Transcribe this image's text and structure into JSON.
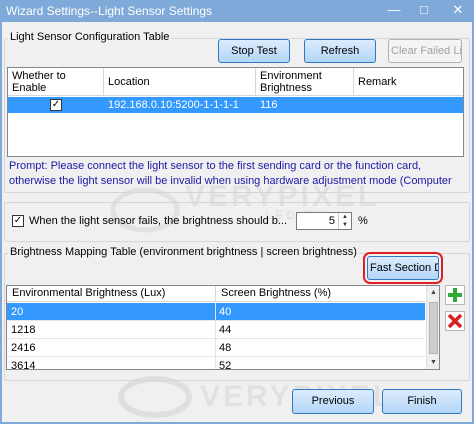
{
  "window": {
    "title": "Wizard Settings--Light Sensor Settings",
    "minimize_glyph": "—",
    "maximize_glyph": "□",
    "close_glyph": "✕",
    "title_bar_color": "#7fa9d8"
  },
  "sensor_config": {
    "group_label": "Light Sensor Configuration Table",
    "buttons": {
      "stop_test": "Stop Test",
      "refresh": "Refresh",
      "clear_failed": "Clear Failed Li..."
    },
    "columns": [
      "Whether to Enable",
      "Location",
      "Environment Brightness",
      "Remark"
    ],
    "rows": [
      {
        "enabled": true,
        "location": "192.168.0.10:5200-1-1-1-1",
        "brightness": "116",
        "remark": ""
      }
    ],
    "prompt": "Prompt: Please connect the light sensor to the first sending card or the function card, otherwise the light sensor will be invalid when using hardware adjustment mode (Computer and hardware not co..."
  },
  "fail_setting": {
    "checked": true,
    "label": "When the light sensor fails, the brightness should b...",
    "value": "5",
    "unit": "%"
  },
  "mapping": {
    "group_label": "Brightness Mapping Table (environment brightness | screen brightness)",
    "fast_section_button": "Fast Section D...",
    "columns": [
      "Environmental Brightness (Lux)",
      "Screen Brightness (%)"
    ],
    "rows": [
      {
        "env": "20",
        "screen": "40",
        "selected": true
      },
      {
        "env": "1218",
        "screen": "44"
      },
      {
        "env": "2416",
        "screen": "48"
      },
      {
        "env": "3614",
        "screen": "52"
      }
    ],
    "add_icon": "green-plus-icon",
    "remove_icon": "red-x-icon"
  },
  "footer": {
    "previous": "Previous",
    "finish": "Finish"
  },
  "watermark": {
    "text": "VERYPIXEL",
    "sub": "LED EX..."
  },
  "colors": {
    "selection": "#3399ff",
    "prompt_text": "#1a1aa6",
    "highlight_border": "#e02020",
    "add_green": "#2ea836",
    "remove_red": "#d42020"
  }
}
